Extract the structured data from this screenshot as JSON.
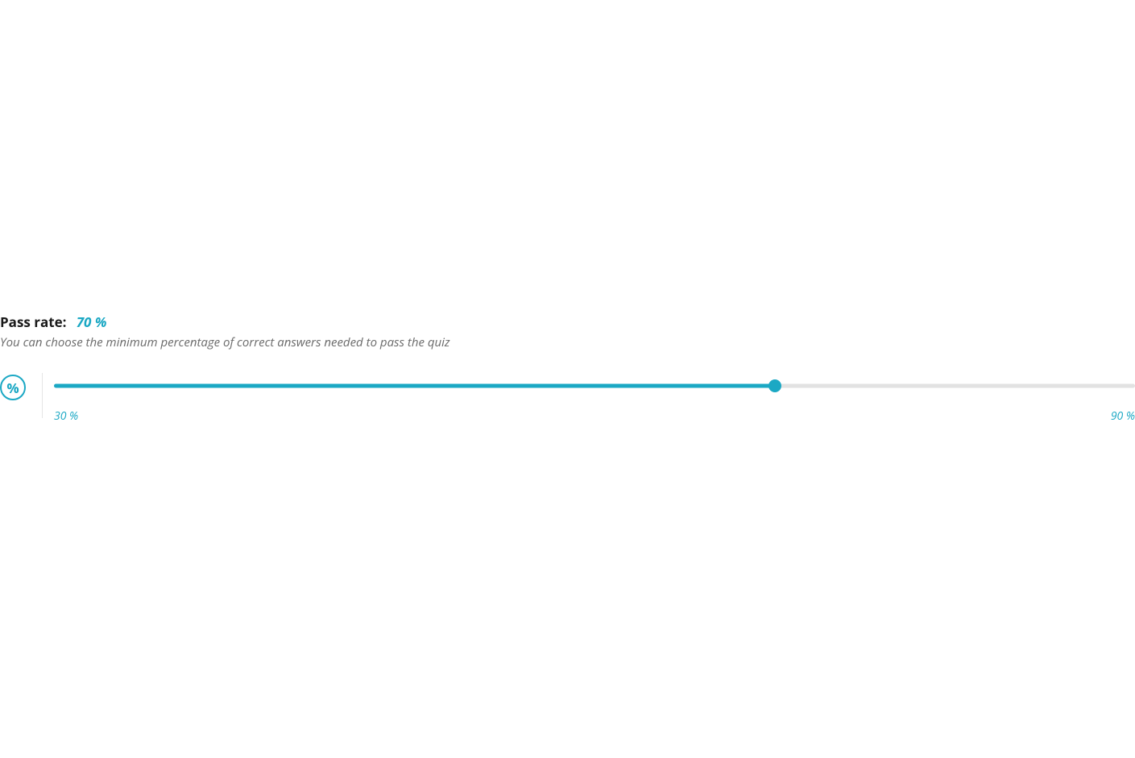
{
  "passRate": {
    "label": "Pass rate:",
    "value": "70 %",
    "description": "You can choose the minimum percentage of correct answers needed to pass the quiz"
  },
  "slider": {
    "min": 30,
    "max": 90,
    "current": 70,
    "minLabel": "30 %",
    "maxLabel": "90 %",
    "iconGlyph": "%"
  },
  "colors": {
    "accent": "#1ba8c4",
    "trackBg": "#e2e2e2",
    "textMuted": "#6a6a6a"
  }
}
